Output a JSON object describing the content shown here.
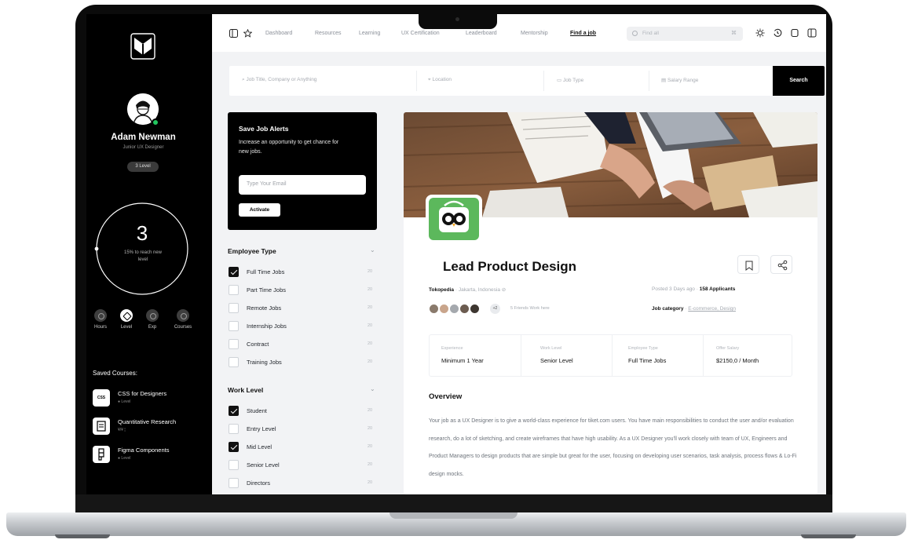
{
  "sidebar": {
    "user_name": "Adam Newman",
    "user_role": "Junior UX Designer",
    "level_badge": "3 Level",
    "progress": {
      "value": 3,
      "text": "15% to reach new level",
      "fraction": 0.15
    },
    "stats": [
      {
        "label": "Hours",
        "icon": "clock-icon"
      },
      {
        "label": "Level",
        "icon": "level-icon"
      },
      {
        "label": "Exp",
        "icon": "briefcase-icon"
      },
      {
        "label": "Courses",
        "icon": "book-icon"
      }
    ],
    "saved_title": "Saved Courses:",
    "courses": [
      {
        "title": "CSS for Designers",
        "sub": "● Level",
        "icon": "css"
      },
      {
        "title": "Quantitative Research",
        "sub": "¥/¥ ¦",
        "icon": "doc"
      },
      {
        "title": "Figma Components",
        "sub": "● Level",
        "icon": "figma"
      }
    ]
  },
  "nav": {
    "links": [
      "Dashboard",
      "Resources",
      "Learning",
      "UX Certification",
      "Leaderboard",
      "Mentorship",
      "Find a job"
    ],
    "active": "Find a job",
    "search_placeholder": "Find all",
    "search_clear": "⌘"
  },
  "search": {
    "keyword_placeholder": "Job Title, Company or Anything",
    "location_placeholder": "Location",
    "type_placeholder": "Job Type",
    "salary_placeholder": "Salary Range",
    "button": "Search"
  },
  "alert": {
    "title": "Save Job Alerts",
    "description": "Increase an opportunity to get chance for new jobs.",
    "email_placeholder": "Type Your Email",
    "button": "Activate"
  },
  "filters": {
    "employee_type": {
      "title": "Employee Type",
      "items": [
        {
          "label": "Full Time Jobs",
          "count": "20",
          "checked": true
        },
        {
          "label": "Part Time Jobs",
          "count": "20",
          "checked": false
        },
        {
          "label": "Remote Jobs",
          "count": "20",
          "checked": false
        },
        {
          "label": "Internship Jobs",
          "count": "20",
          "checked": false
        },
        {
          "label": "Contract",
          "count": "20",
          "checked": false
        },
        {
          "label": "Training Jobs",
          "count": "20",
          "checked": false
        }
      ]
    },
    "work_level": {
      "title": "Work Level",
      "items": [
        {
          "label": "Student",
          "count": "20",
          "checked": true
        },
        {
          "label": "Entry Level",
          "count": "20",
          "checked": false
        },
        {
          "label": "Mid Level",
          "count": "20",
          "checked": true
        },
        {
          "label": "Senior Level",
          "count": "20",
          "checked": false
        },
        {
          "label": "Directors",
          "count": "20",
          "checked": false
        }
      ]
    }
  },
  "job": {
    "title": "Lead Product Design",
    "company": "Tokopedia",
    "location": "Jakarta, Indonesia",
    "posted": "Posted 3 Days ago",
    "applicants": "158 Applicants",
    "friends_count": "+2",
    "friends_text": "5 Friends Work here",
    "category_label": "Job category",
    "category_value": "E-commerce, Design",
    "info": [
      {
        "key": "Experience",
        "value": "Minimum 1 Year"
      },
      {
        "key": "Work Level",
        "value": "Senior Level"
      },
      {
        "key": "Employee Type",
        "value": "Full Time Jobs"
      },
      {
        "key": "Offer Salary",
        "value": "$2150,0 / Month"
      }
    ],
    "overview_title": "Overview",
    "overview_text": "Your job as a UX Designer is to give a world-class experience for tiket.com users. You have main responsibilities to conduct the user and/or evaluation research, do a lot of sketching, and create wireframes that have high usability. As a UX Designer you'll work closely with team of UX, Engineers and Product Managers to design products that are simple but great for the user, focusing on developing user scenarios, task analysis, process flows & Lo-Fi design mocks."
  },
  "colors": {
    "accent": "#000000",
    "online": "#22c55e",
    "company_brand": "#5cb85c"
  }
}
